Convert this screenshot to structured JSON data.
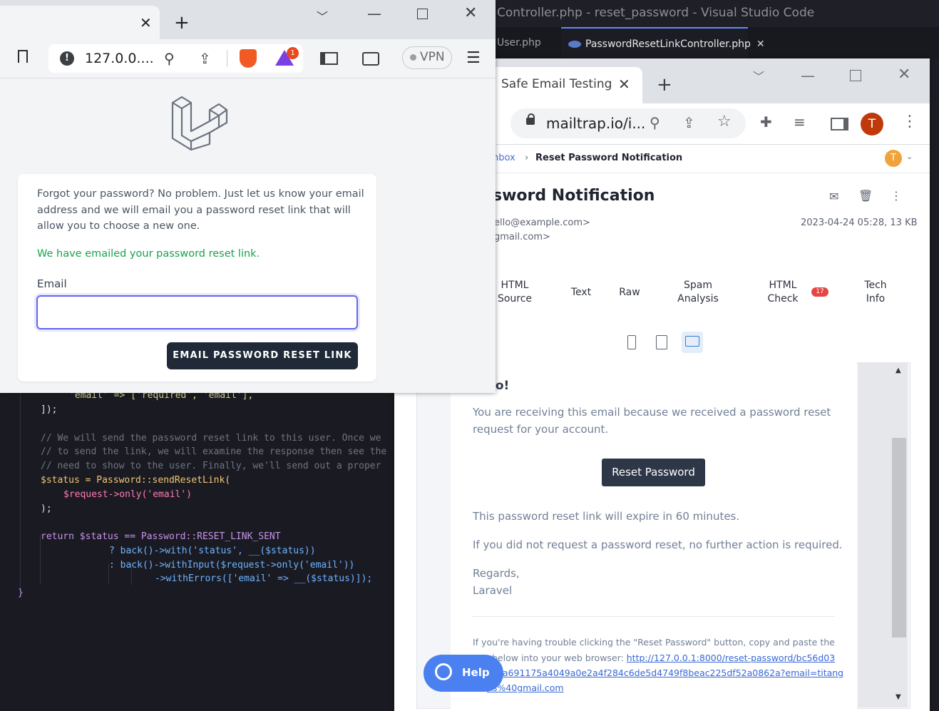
{
  "vscode": {
    "window_title": "Controller.php - reset_password - Visual Studio Code",
    "tabs": [
      {
        "label": "User.php"
      },
      {
        "label": "PasswordResetLinkController.php"
      }
    ],
    "code_lines": [
      "'email' => ['required', 'email'],",
      "]);",
      "// We will send the password reset link to this user. Once we",
      "// to send the link, we will examine the response then see the",
      "// need to show to the user. Finally, we'll send out a proper",
      "$status = Password::sendResetLink(",
      "$request->only('email')",
      ");",
      "return $status == Password::RESET_LINK_SENT",
      "? back()->with('status', __($status))",
      ": back()->withInput($request->only('email'))",
      "->withErrors(['email' => __($status)]);",
      "}"
    ]
  },
  "chrome": {
    "tab_title": "Safe Email Testing",
    "url": "mailtrap.io/i...",
    "avatar_letter": "T"
  },
  "mailtrap": {
    "breadcrumb": {
      "inbox": "nbox",
      "separator": "›",
      "current": "Reset Password Notification"
    },
    "user_initial": "T",
    "subject": "sword Notification",
    "from": "ello@example.com>",
    "to": "gmail.com>",
    "meta": "2023-04-24 05:28, 13 KB",
    "tabs": [
      {
        "label": "HTML Source"
      },
      {
        "label": "Text"
      },
      {
        "label": "Raw"
      },
      {
        "label": "Spam Analysis"
      },
      {
        "label": "HTML Check"
      },
      {
        "label": "Tech Info"
      }
    ],
    "html_check_badge": "17",
    "email": {
      "greeting": "lo!",
      "p1_line1": "You are receiving this email because we received a password reset",
      "p1_line2": "request for your account.",
      "button": "Reset Password",
      "p2": "This password reset link will expire in 60 minutes.",
      "p3": "If you did not request a password reset, no further action is required.",
      "regards": "Regards,",
      "signature": "Laravel",
      "trouble_line1": "If you're having trouble clicking the \"Reset Password\" button, copy and paste the",
      "trouble_line2_text": "below into your web browser: ",
      "link_line1": "http://127.0.0.1:8000/reset-password/bc56d03",
      "link_line2": "ca691175a4049a0e2a4f284c6de5d4749f8beac225df52a0862a?email=titang",
      "link_line3": "ns%40gmail.com"
    },
    "help_label": "Help"
  },
  "brave": {
    "url": "127.0.0....",
    "vpn_label": "VPN",
    "rewards_badge": "1",
    "intro_line1": "Forgot your password? No problem. Just let us know your email",
    "intro_line2": "address and we will email you a password reset link that will",
    "intro_line3": "allow you to choose a new one.",
    "status": "We have emailed your password reset link.",
    "email_label": "Email",
    "email_value": "",
    "submit": "EMAIL PASSWORD RESET LINK"
  }
}
